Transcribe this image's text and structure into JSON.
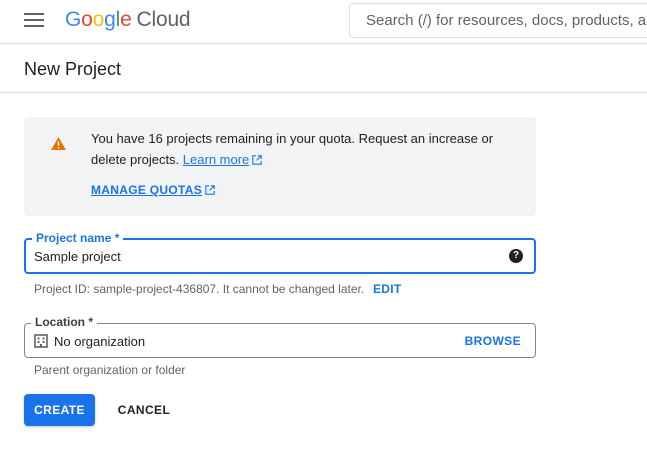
{
  "header": {
    "logo_google": [
      "G",
      "o",
      "o",
      "g",
      "l",
      "e"
    ],
    "logo_cloud": "Cloud",
    "search_placeholder": "Search (/) for resources, docs, products, and more"
  },
  "page": {
    "title": "New Project"
  },
  "notice": {
    "icon": "warning-icon",
    "text_before": "You have 16 projects remaining in your quota. Request an increase or delete projects.",
    "learn_more": "Learn more",
    "manage_quotas": "MANAGE QUOTAS"
  },
  "form": {
    "project_name_label": "Project name *",
    "project_name_value": "Sample project",
    "project_id_text": "Project ID: sample-project-436807. It cannot be changed later.",
    "edit_label": "EDIT",
    "location_label": "Location *",
    "location_value": "No organization",
    "browse_label": "BROWSE",
    "location_hint": "Parent organization or folder",
    "create_label": "CREATE",
    "cancel_label": "CANCEL"
  },
  "colors": {
    "accent": "#1a73e8",
    "warning": "#e37400",
    "notice_bg": "#f1f3f4"
  }
}
